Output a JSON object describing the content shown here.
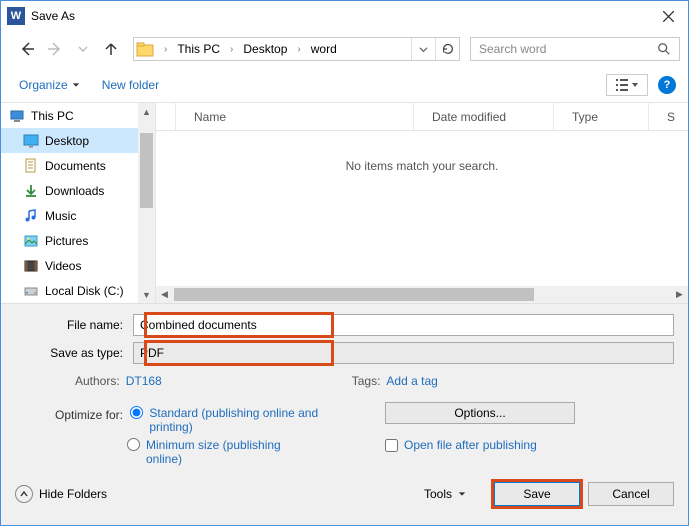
{
  "window": {
    "title": "Save As"
  },
  "nav": {
    "breadcrumbs": [
      "This PC",
      "Desktop",
      "word"
    ],
    "search_placeholder": "Search word"
  },
  "toolbar": {
    "organize": "Organize",
    "new_folder": "New folder"
  },
  "tree": {
    "items": [
      {
        "label": "This PC",
        "icon": "pc",
        "top": true
      },
      {
        "label": "Desktop",
        "icon": "desktop",
        "selected": true
      },
      {
        "label": "Documents",
        "icon": "documents"
      },
      {
        "label": "Downloads",
        "icon": "downloads"
      },
      {
        "label": "Music",
        "icon": "music"
      },
      {
        "label": "Pictures",
        "icon": "pictures"
      },
      {
        "label": "Videos",
        "icon": "videos"
      },
      {
        "label": "Local Disk (C:)",
        "icon": "disk"
      }
    ]
  },
  "filelist": {
    "cols": [
      "Name",
      "Date modified",
      "Type",
      "S"
    ],
    "empty_text": "No items match your search."
  },
  "form": {
    "file_name_label": "File name:",
    "file_name_value": "Combined documents",
    "save_as_type_label": "Save as type:",
    "save_as_type_value": "PDF",
    "authors_label": "Authors:",
    "authors_value": "DT168",
    "tags_label": "Tags:",
    "tags_value": "Add a tag",
    "optimize_label": "Optimize for:",
    "optimize_standard": "Standard (publishing online and printing)",
    "optimize_minimum": "Minimum size (publishing online)",
    "options_btn": "Options...",
    "open_after": "Open file after publishing"
  },
  "footer": {
    "hide_folders": "Hide Folders",
    "tools": "Tools",
    "save": "Save",
    "cancel": "Cancel"
  }
}
